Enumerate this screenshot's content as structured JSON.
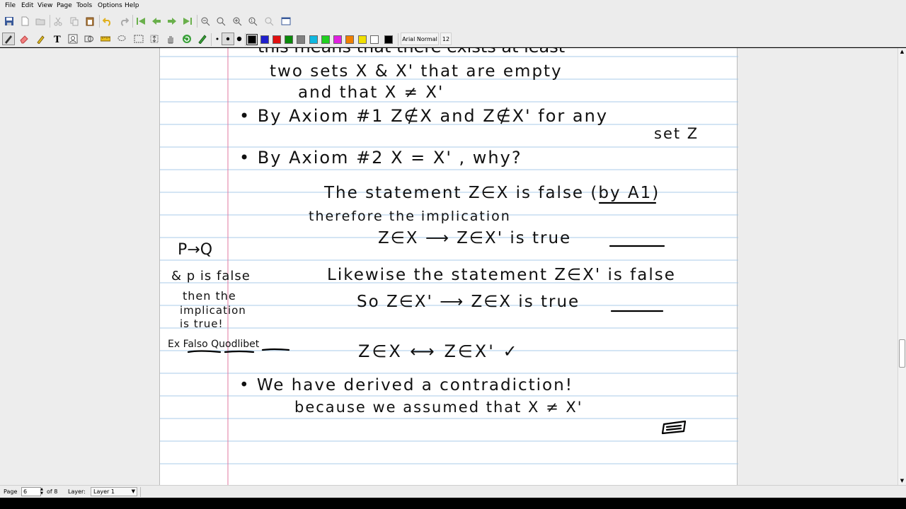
{
  "menu": {
    "items": [
      "File",
      "Edit",
      "View",
      "Page",
      "Tools",
      "Options",
      "Help"
    ]
  },
  "toolbar": {
    "font_name": "Arial Normal",
    "font_size": "12",
    "colors": [
      "#000000",
      "#1f1fcc",
      "#e01010",
      "#0a8a0a",
      "#808080",
      "#10b8e0",
      "#20d020",
      "#e020e0",
      "#f08000",
      "#f0e000",
      "#ffffff",
      "#000000"
    ]
  },
  "note": {
    "lines": [
      "this means that there exists at least",
      "two sets X & X' that are empty",
      "and that X ≠ X'",
      "• By Axiom #1  Z∉X  and Z∉X' for any",
      "set Z",
      "• By Axiom #2  X = X' , why?",
      "The statement Z∈X is false (by A1)",
      "therefore the implication",
      "Z∈X ⟶ Z∈X' is true",
      "Likewise the statement Z∈X' is false",
      "So Z∈X' ⟶ Z∈X is true",
      "Z∈X ⟷ Z∈X'  ✓",
      "• We have derived a contradiction!",
      "because we assumed that X ≠ X'",
      "P→Q",
      "& p is false",
      "then the",
      "implication",
      "is true!",
      "Ex Falso Quodlibet"
    ]
  },
  "status": {
    "page_label": "Page",
    "page_value": "6",
    "of_label": "of 8",
    "layer_label": "Layer:",
    "layer_value": "Layer 1"
  }
}
